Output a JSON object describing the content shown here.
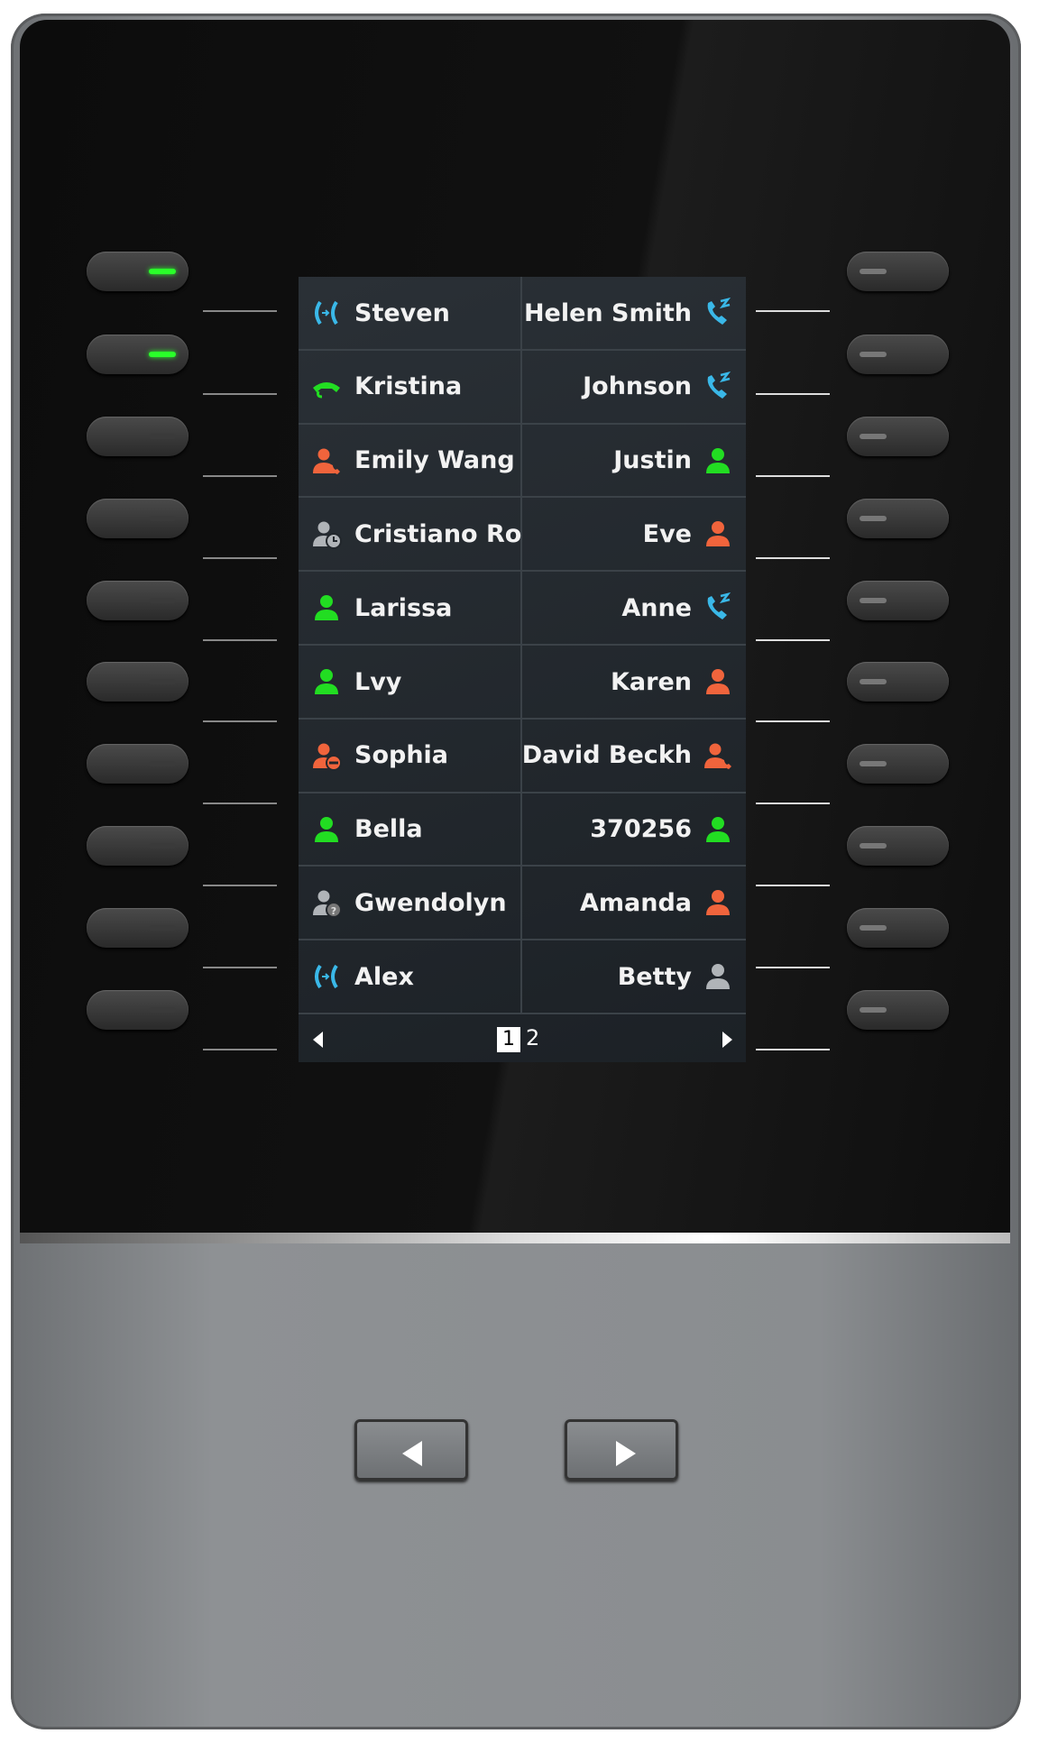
{
  "colors": {
    "green": "#22dd22",
    "orange": "#f0643c",
    "blue": "#3ab8e8",
    "gray": "#b0b4b8"
  },
  "left_keys": [
    {
      "led": "on"
    },
    {
      "led": "on"
    },
    {
      "led": "off"
    },
    {
      "led": "off"
    },
    {
      "led": "off"
    },
    {
      "led": "off"
    },
    {
      "led": "off"
    },
    {
      "led": "off"
    },
    {
      "led": "off"
    },
    {
      "led": "off"
    }
  ],
  "contacts_left": [
    {
      "name": "Steven",
      "icon": "conference-icon",
      "color": "blue"
    },
    {
      "name": "Kristina",
      "icon": "handset-icon",
      "color": "green"
    },
    {
      "name": "Emily Wang",
      "icon": "user-calling-icon",
      "color": "orange"
    },
    {
      "name": "Cristiano Ro",
      "icon": "user-away-icon",
      "color": "gray"
    },
    {
      "name": "Larissa",
      "icon": "user-icon",
      "color": "green"
    },
    {
      "name": "Lvy",
      "icon": "user-icon",
      "color": "green"
    },
    {
      "name": "Sophia",
      "icon": "user-dnd-icon",
      "color": "orange"
    },
    {
      "name": "Bella",
      "icon": "user-icon",
      "color": "green"
    },
    {
      "name": "Gwendolyn",
      "icon": "user-unknown-icon",
      "color": "gray"
    },
    {
      "name": "Alex",
      "icon": "conference-icon",
      "color": "blue"
    }
  ],
  "contacts_right": [
    {
      "name": "Helen Smith",
      "icon": "ringing-phone-icon",
      "color": "blue"
    },
    {
      "name": "Johnson",
      "icon": "ringing-phone-icon",
      "color": "blue"
    },
    {
      "name": "Justin",
      "icon": "user-icon",
      "color": "green"
    },
    {
      "name": "Eve",
      "icon": "user-icon",
      "color": "orange"
    },
    {
      "name": "Anne",
      "icon": "ringing-phone-icon",
      "color": "blue"
    },
    {
      "name": "Karen",
      "icon": "user-icon",
      "color": "orange"
    },
    {
      "name": "David Beckh",
      "icon": "user-calling-icon",
      "color": "orange"
    },
    {
      "name": "370256",
      "icon": "user-icon",
      "color": "green"
    },
    {
      "name": "Amanda",
      "icon": "user-icon",
      "color": "orange"
    },
    {
      "name": "Betty",
      "icon": "user-icon",
      "color": "gray"
    }
  ],
  "pager": {
    "current": "1",
    "next": "2"
  }
}
